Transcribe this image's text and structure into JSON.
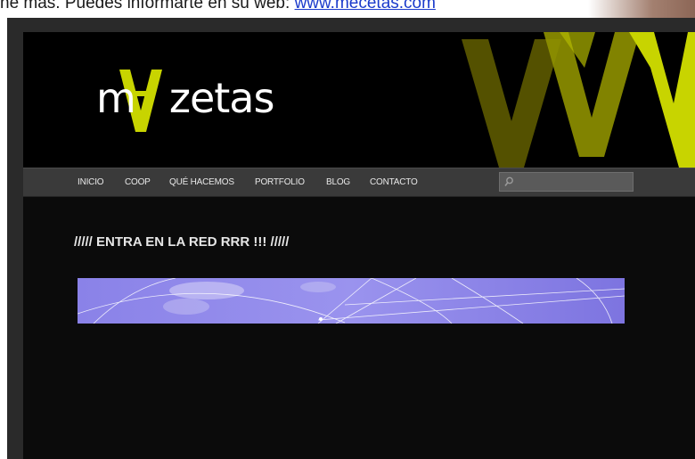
{
  "top_strip": {
    "text": "ne más. Puedes informarte en su web: ",
    "link_text": "www.mecetas.com"
  },
  "site": {
    "logo_text_left": "m",
    "logo_text_right": "zetas",
    "logo_accent_color": "#c8d400",
    "nav": [
      {
        "label": "INICIO"
      },
      {
        "label": "COOP"
      },
      {
        "label": "QUÉ HACEMOS"
      },
      {
        "label": "PORTFOLIO"
      },
      {
        "label": "BLOG"
      },
      {
        "label": "CONTACTO"
      }
    ],
    "search": {
      "placeholder": "",
      "value": ""
    },
    "icons": {
      "search": "search-icon"
    },
    "post": {
      "title": "///// ENTRA EN LA RED RRR !!! /////"
    }
  }
}
